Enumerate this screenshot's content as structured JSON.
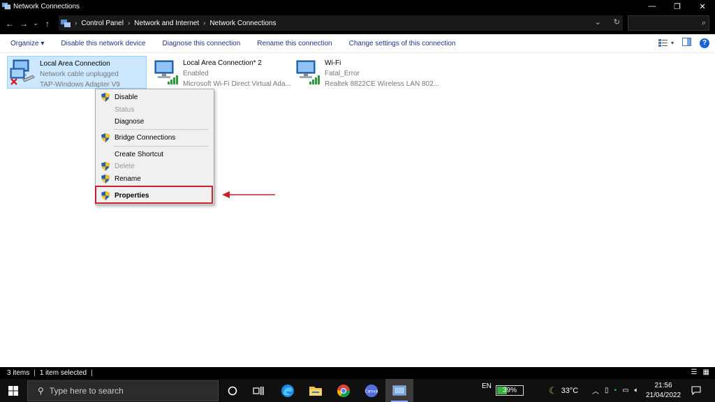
{
  "window": {
    "title": "Network Connections"
  },
  "address": {
    "crumbs": [
      "Control Panel",
      "Network and Internet",
      "Network Connections"
    ],
    "search_placeholder": ""
  },
  "toolbar": {
    "organize": "Organize ▾",
    "disable": "Disable this network device",
    "diagnose": "Diagnose this connection",
    "rename": "Rename this connection",
    "change": "Change settings of this connection"
  },
  "items": [
    {
      "name": "Local Area Connection",
      "status": "Network cable unplugged",
      "adapter": "TAP-Windows Adapter V9"
    },
    {
      "name": "Local Area Connection* 2",
      "status": "Enabled",
      "adapter": "Microsoft Wi-Fi Direct Virtual Ada..."
    },
    {
      "name": "Wi-Fi",
      "status": "Fatal_Error",
      "adapter": "Realtek 8822CE Wireless LAN 802..."
    }
  ],
  "context_menu": {
    "disable": "Disable",
    "status": "Status",
    "diagnose": "Diagnose",
    "bridge": "Bridge Connections",
    "shortcut": "Create Shortcut",
    "delete": "Delete",
    "rename": "Rename",
    "properties": "Properties"
  },
  "statusbar": {
    "count": "3 items",
    "selected": "1 item selected"
  },
  "taskbar": {
    "search_placeholder": "Type here to search",
    "language": "EN",
    "battery_percent": "39%",
    "battery_level": 0.39,
    "weather": "33°C",
    "time": "21:56",
    "date": "21/04/2022"
  },
  "colors": {
    "accent_red": "#c8202a",
    "selection": "#cce8ff",
    "link_blue": "#1e3287"
  }
}
